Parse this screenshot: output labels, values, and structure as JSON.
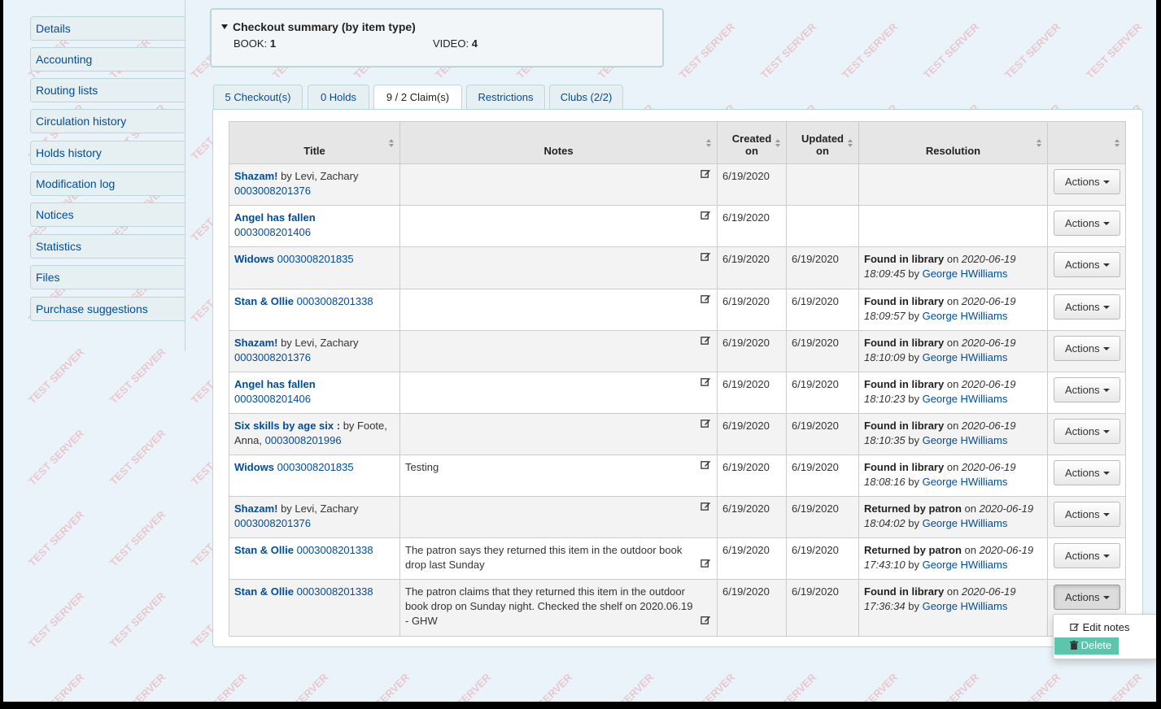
{
  "sidebar": {
    "items": [
      {
        "label": "Details"
      },
      {
        "label": "Accounting"
      },
      {
        "label": "Routing lists"
      },
      {
        "label": "Circulation history"
      },
      {
        "label": "Holds history"
      },
      {
        "label": "Modification log"
      },
      {
        "label": "Notices"
      },
      {
        "label": "Statistics"
      },
      {
        "label": "Files"
      },
      {
        "label": "Purchase suggestions"
      }
    ]
  },
  "watermark": "TEST SERVER",
  "checkout_summary": {
    "title": "Checkout summary (by item type)",
    "book_label": "BOOK:",
    "book_count": "1",
    "video_label": "VIDEO:",
    "video_count": "4"
  },
  "tabs": [
    {
      "label": "5 Checkout(s)"
    },
    {
      "label": "0 Holds"
    },
    {
      "label": "9 / 2 Claim(s)",
      "active": true
    },
    {
      "label": "Restrictions"
    },
    {
      "label": "Clubs (2/2)"
    }
  ],
  "table": {
    "headers": {
      "title": "Title",
      "notes": "Notes",
      "created_1": "Created",
      "created_2": "on",
      "updated_1": "Updated",
      "updated_2": "on",
      "resolution": "Resolution"
    },
    "actions_label": "Actions",
    "rows": [
      {
        "title": "Shazam!",
        "author": " by Levi, Zachary",
        "barcode": "0003008201376",
        "notes": "",
        "created": "6/19/2020",
        "updated": "",
        "res_status": "",
        "res_on": "",
        "res_date": "",
        "res_time": "",
        "res_by": "",
        "res_user": ""
      },
      {
        "title": "Angel has fallen",
        "author": "",
        "barcode": "0003008201406",
        "notes": "",
        "created": "6/19/2020",
        "updated": "",
        "res_status": "",
        "res_on": "",
        "res_date": "",
        "res_time": "",
        "res_by": "",
        "res_user": ""
      },
      {
        "title": "Widows",
        "author": "",
        "barcode": "0003008201835",
        "notes": "",
        "created": "6/19/2020",
        "updated": "6/19/2020",
        "res_status": "Found in library",
        "res_on": " on ",
        "res_date": "2020-06-19",
        "res_time": "18:09:45",
        "res_by": " by ",
        "res_user": "George HWilliams"
      },
      {
        "title": "Stan & Ollie",
        "author": "",
        "barcode": "0003008201338",
        "notes": "",
        "created": "6/19/2020",
        "updated": "6/19/2020",
        "res_status": "Found in library",
        "res_on": " on ",
        "res_date": "2020-06-19",
        "res_time": "18:09:57",
        "res_by": " by ",
        "res_user": "George HWilliams"
      },
      {
        "title": "Shazam!",
        "author": " by Levi, Zachary",
        "barcode": "0003008201376",
        "notes": "",
        "created": "6/19/2020",
        "updated": "6/19/2020",
        "res_status": "Found in library",
        "res_on": " on ",
        "res_date": "2020-06-19",
        "res_time": "18:10:09",
        "res_by": " by ",
        "res_user": "George HWilliams"
      },
      {
        "title": "Angel has fallen",
        "author": "",
        "barcode": "0003008201406",
        "notes": "",
        "created": "6/19/2020",
        "updated": "6/19/2020",
        "res_status": "Found in library",
        "res_on": " on ",
        "res_date": "2020-06-19",
        "res_time": "18:10:23",
        "res_by": " by ",
        "res_user": "George HWilliams"
      },
      {
        "title": "Six skills by age six :",
        "author": " by Foote, Anna,",
        "barcode": "0003008201996",
        "notes": "",
        "created": "6/19/2020",
        "updated": "6/19/2020",
        "res_status": "Found in library",
        "res_on": " on ",
        "res_date": "2020-06-19",
        "res_time": "18:10:35",
        "res_by": " by ",
        "res_user": "George HWilliams"
      },
      {
        "title": "Widows",
        "author": "",
        "barcode": "0003008201835",
        "notes": "Testing",
        "created": "6/19/2020",
        "updated": "6/19/2020",
        "res_status": "Found in library",
        "res_on": " on ",
        "res_date": "2020-06-19",
        "res_time": "18:08:16",
        "res_by": " by ",
        "res_user": "George HWilliams"
      },
      {
        "title": "Shazam!",
        "author": " by Levi, Zachary",
        "barcode": "0003008201376",
        "notes": "",
        "created": "6/19/2020",
        "updated": "6/19/2020",
        "res_status": "Returned by patron",
        "res_on": " on ",
        "res_date": "2020-06-19",
        "res_time": "18:04:02",
        "res_by": " by ",
        "res_user": "George HWilliams"
      },
      {
        "title": "Stan & Ollie",
        "author": "",
        "barcode": "0003008201338",
        "notes": "The patron says they returned this item in the outdoor book drop last Sunday",
        "created": "6/19/2020",
        "updated": "6/19/2020",
        "res_status": "Returned by patron",
        "res_on": " on ",
        "res_date": "2020-06-19",
        "res_time": "17:43:10",
        "res_by": " by ",
        "res_user": "George HWilliams"
      },
      {
        "title": "Stan & Ollie",
        "author": "",
        "barcode": "0003008201338",
        "notes": "The patron claims that they returned this item in the outdoor book drop on Sunday night. Checked the shelf on 2020.06.19 - GHW",
        "created": "6/19/2020",
        "updated": "6/19/2020",
        "res_status": "Found in library",
        "res_on": " on ",
        "res_date": "2020-06-19",
        "res_time": "17:36:34",
        "res_by": " by ",
        "res_user": "George HWilliams"
      }
    ]
  },
  "dropdown": {
    "edit_label": "Edit notes",
    "delete_label": "Delete"
  },
  "colors": {
    "link": "#004d99",
    "delete_bg": "#5cc6ad",
    "page_bg": "#eaf3fa"
  }
}
